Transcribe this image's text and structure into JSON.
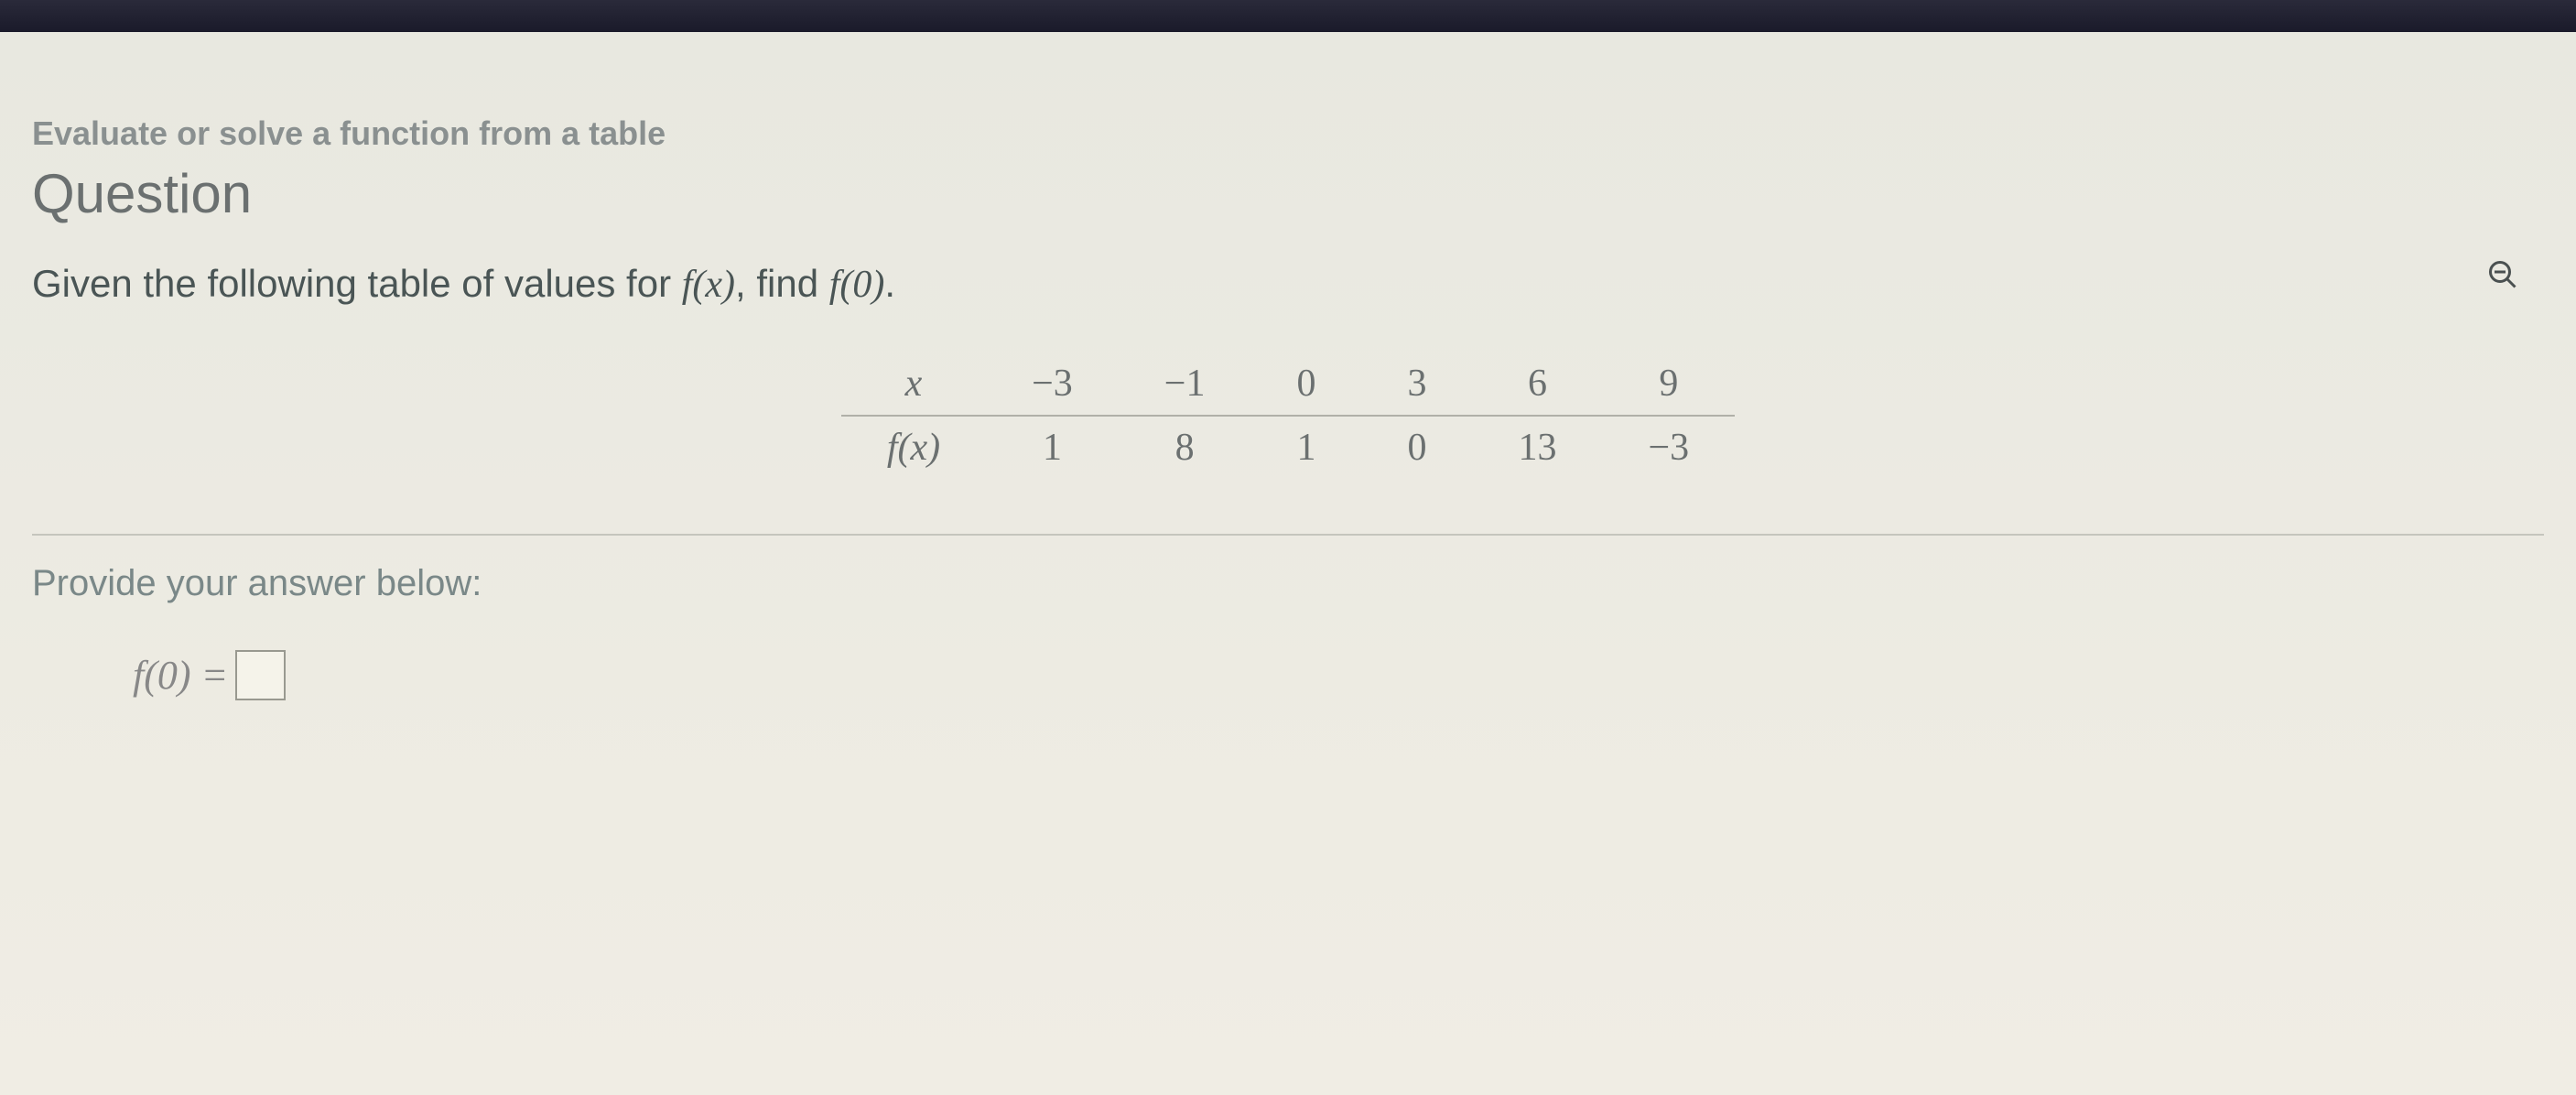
{
  "topic": "Evaluate or solve a function from a table",
  "heading": "Question",
  "prompt_prefix": "Given the following table of values for ",
  "prompt_fx": "f(x)",
  "prompt_mid": ", find ",
  "prompt_target": "f(0)",
  "prompt_suffix": ".",
  "table": {
    "row_x_label": "x",
    "row_fx_label": "f(x)",
    "x_values": [
      "−3",
      "−1",
      "0",
      "3",
      "6",
      "9"
    ],
    "fx_values": [
      "1",
      "8",
      "1",
      "0",
      "13",
      "−3"
    ]
  },
  "answer_label": "Provide your answer below:",
  "answer_expr": "f(0) =",
  "answer_value": ""
}
